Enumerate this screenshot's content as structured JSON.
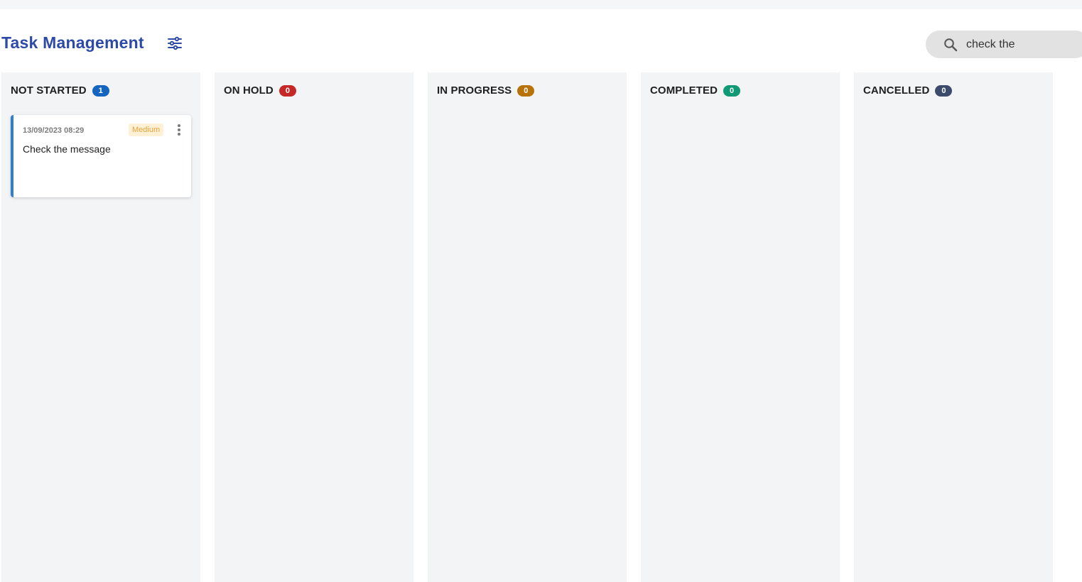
{
  "header": {
    "title": "Task Management",
    "filter_icon": "sliders-icon",
    "title_color": "#2e4aa8"
  },
  "search": {
    "value": "check the",
    "icon": "search-icon"
  },
  "columns": [
    {
      "title": "NOT STARTED",
      "count": "1",
      "badge_color": "#1565c0"
    },
    {
      "title": "ON HOLD",
      "count": "0",
      "badge_color": "#c62828"
    },
    {
      "title": "IN PROGRESS",
      "count": "0",
      "badge_color": "#b8720a"
    },
    {
      "title": "COMPLETED",
      "count": "0",
      "badge_color": "#0f9a75"
    },
    {
      "title": "CANCELLED",
      "count": "0",
      "badge_color": "#3c4a6b"
    }
  ],
  "tasks": [
    {
      "date": "13/09/2023 08:29",
      "priority": "Medium",
      "title": "Check the message",
      "accent_color": "#2f80cc",
      "menu_icon": "more-vertical-icon"
    }
  ]
}
